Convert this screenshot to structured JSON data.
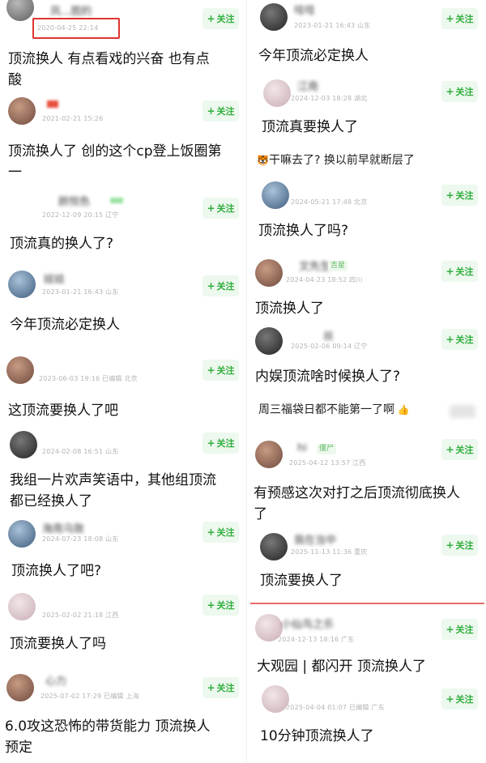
{
  "follow_label": "关注",
  "left": [
    {
      "username": "凤...图的",
      "meta": "2020-04-25 22:14",
      "comment": "顶流换人 有点看戏的兴奋 也有点\n酸"
    },
    {
      "username": "",
      "meta": "2021-02-21 15:26",
      "comment": "顶流换人了 创的这个cp登上饭圈第\n一"
    },
    {
      "username": "颜悦色",
      "meta": "2022-12-09 20:15 辽宁",
      "comment": "顶流真的换人了?"
    },
    {
      "username": "娃娃",
      "meta": "2023-01-21 16:43 山东",
      "comment": "今年顶流必定换人"
    },
    {
      "username": "",
      "meta": "2023-06-03 19:16 已编辑 北京",
      "comment": "这顶流要换人了吧"
    },
    {
      "username": "",
      "meta": "2024-02-08 16:51 山东",
      "comment": "我组一片欢声笑语中，其他组顶流\n都已经换人了"
    },
    {
      "username": "海南乌致",
      "meta": "2024-07-23 18:08 山东",
      "comment": "顶流换人了吧?"
    },
    {
      "username": "",
      "meta": "2025-02-02 21:18 江西",
      "comment": "顶流要换人了吗"
    },
    {
      "username": "心力",
      "meta": "2025-07-02 17:29 已编辑 上海",
      "comment": "6.0攻这恐怖的带货能力 顶流换人\n预定"
    }
  ],
  "right": [
    {
      "username": "哇哇",
      "meta": "2023-01-21 16:43 山东",
      "comment": "今年顶流必定换人"
    },
    {
      "username": "江南",
      "meta": "2024-12-03 18:28 湖北",
      "comment": "顶流真要换人了",
      "reply": "干嘛去了? 换以前早就断层了"
    },
    {
      "username": "",
      "meta": "2024-05-21 17:48 北京",
      "comment": "顶流换人了吗?"
    },
    {
      "username": "文先生",
      "badge": "吉星",
      "meta": "2024-04-23 18:52 四川",
      "comment": "顶流换人了"
    },
    {
      "username": "丝",
      "meta": "2025-02-06 09:14 辽宁",
      "comment": "内娱顶流啥时候换人了?",
      "reply": "周三福袋日都不能第一了啊"
    },
    {
      "username": "hi",
      "badge": "僵尸",
      "meta": "2025-04-12 13:57 江西",
      "comment": "有预感这次对打之后顶流彻底换人\n了"
    },
    {
      "username": "我在当中",
      "meta": "2025-11-13 11:36 重庆",
      "comment": "顶流要换人了"
    },
    {
      "username": "小仙鸟之乐",
      "meta": "2024-12-13 18:16 广东",
      "comment": "大观园 | 都闪开 顶流换人了"
    },
    {
      "username": "",
      "meta": "2025-04-04 01:07 已编辑 广东",
      "comment": "10分钟顶流换人了"
    }
  ]
}
